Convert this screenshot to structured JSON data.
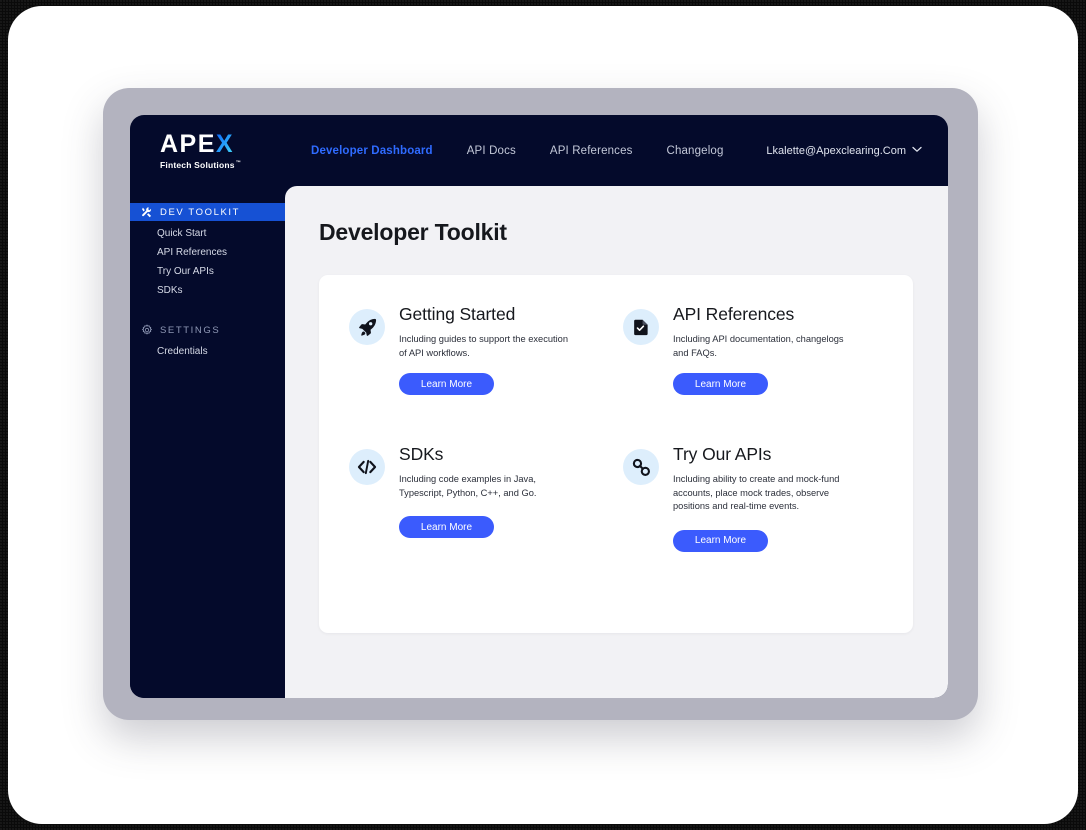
{
  "brand": {
    "wordmark_prefix": "APE",
    "wordmark_accent": "X",
    "tagline": "Fintech Solutions",
    "trademark": "™",
    "accent_color": "#29b6f6"
  },
  "topnav": {
    "links": [
      {
        "label": "Developer Dashboard",
        "active": true
      },
      {
        "label": "API Docs",
        "active": false
      },
      {
        "label": "API References",
        "active": false
      },
      {
        "label": "Changelog",
        "active": false
      }
    ],
    "account": {
      "email": "Lkalette@Apexclearing.Com",
      "chevron": "⌄"
    },
    "active_color": "#2f6bff"
  },
  "sidebar": {
    "sections": [
      {
        "label": "DEV TOOLKIT",
        "icon": "tools-icon",
        "active": true,
        "highlight_color": "#1651d4",
        "items": [
          {
            "label": "Quick Start"
          },
          {
            "label": "API References"
          },
          {
            "label": "Try Our APIs"
          },
          {
            "label": "SDKs"
          }
        ]
      },
      {
        "label": "SETTINGS",
        "icon": "gear-icon",
        "active": false,
        "items": [
          {
            "label": "Credentials"
          }
        ]
      }
    ]
  },
  "main": {
    "page_title": "Developer Toolkit",
    "cards": [
      {
        "icon": "rocket-icon",
        "title": "Getting Started",
        "description": "Including guides to support the execution of API workflows.",
        "button_label": "Learn More"
      },
      {
        "icon": "document-check-icon",
        "title": "API References",
        "description": "Including API documentation, changelogs and FAQs.",
        "button_label": "Learn More"
      },
      {
        "icon": "code-brackets-icon",
        "title": "SDKs",
        "description": "Including code examples in Java, Typescript, Python, C++, and Go.",
        "button_label": "Learn More"
      },
      {
        "icon": "link-chain-icon",
        "title": "Try Our APIs",
        "description": "Including ability to create and mock-fund accounts, place mock trades, observe positions and real-time events.",
        "button_label": "Learn More"
      }
    ],
    "button_color": "#3b5bfd",
    "icon_circle_color": "#ddeefc",
    "content_bg": "#f2f2f5",
    "panel_bg": "#ffffff"
  },
  "chrome": {
    "bezel_color": "#b3b3bf",
    "app_bg": "#040a2b",
    "sheet_color": "#ffffff"
  }
}
